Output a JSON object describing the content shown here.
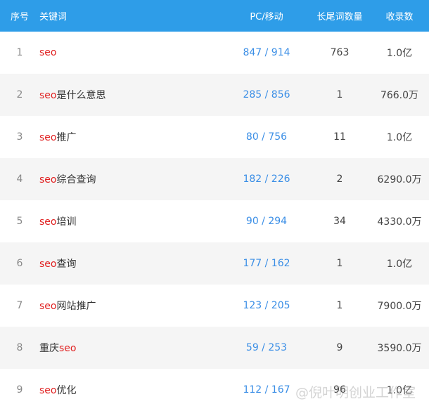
{
  "table": {
    "headers": {
      "index": "序号",
      "keyword": "关键词",
      "pc_mobile": "PC/移动",
      "long_tail": "长尾词数量",
      "indexed": "收录数"
    },
    "rows": [
      {
        "index": "1",
        "pre": "",
        "hl": "seo",
        "post": "",
        "pc_mobile": "847 / 914",
        "long_tail": "763",
        "indexed": "1.0亿"
      },
      {
        "index": "2",
        "pre": "",
        "hl": "seo",
        "post": "是什么意思",
        "pc_mobile": "285 / 856",
        "long_tail": "1",
        "indexed": "766.0万"
      },
      {
        "index": "3",
        "pre": "",
        "hl": "seo",
        "post": "推广",
        "pc_mobile": "80 / 756",
        "long_tail": "11",
        "indexed": "1.0亿"
      },
      {
        "index": "4",
        "pre": "",
        "hl": "seo",
        "post": "综合查询",
        "pc_mobile": "182 / 226",
        "long_tail": "2",
        "indexed": "6290.0万"
      },
      {
        "index": "5",
        "pre": "",
        "hl": "seo",
        "post": "培训",
        "pc_mobile": "90 / 294",
        "long_tail": "34",
        "indexed": "4330.0万"
      },
      {
        "index": "6",
        "pre": "",
        "hl": "seo",
        "post": "查询",
        "pc_mobile": "177 / 162",
        "long_tail": "1",
        "indexed": "1.0亿"
      },
      {
        "index": "7",
        "pre": "",
        "hl": "seo",
        "post": "网站推广",
        "pc_mobile": "123 / 205",
        "long_tail": "1",
        "indexed": "7900.0万"
      },
      {
        "index": "8",
        "pre": "重庆",
        "hl": "seo",
        "post": "",
        "pc_mobile": "59 / 253",
        "long_tail": "9",
        "indexed": "3590.0万"
      },
      {
        "index": "9",
        "pre": "",
        "hl": "seo",
        "post": "优化",
        "pc_mobile": "112 / 167",
        "long_tail": "96",
        "indexed": "1.0亿"
      }
    ]
  },
  "watermark": "@倪叶明创业工作室",
  "colors": {
    "header_bg": "#2e9de8",
    "keyword_highlight": "#e02020",
    "pc_mobile_text": "#3a8ee6",
    "alt_row_bg": "#f5f5f5"
  }
}
